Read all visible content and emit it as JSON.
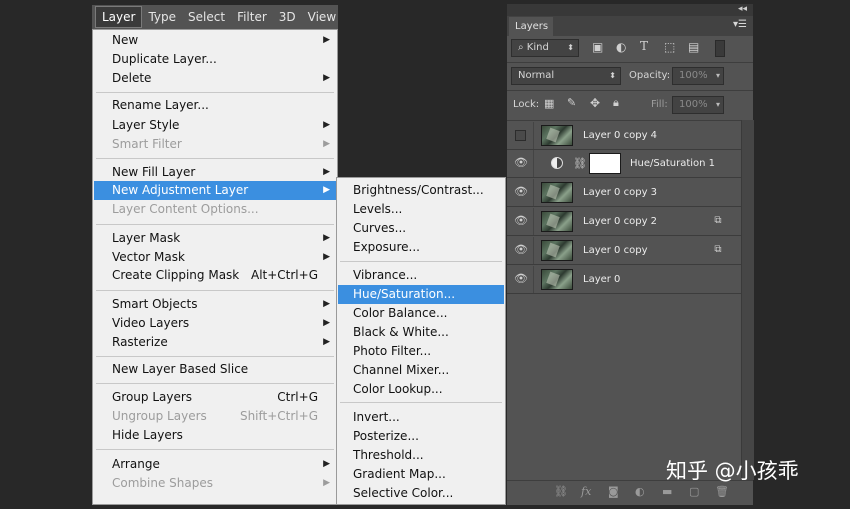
{
  "menubar": {
    "items": [
      "Layer",
      "Type",
      "Select",
      "Filter",
      "3D",
      "View"
    ]
  },
  "layer_menu": {
    "new": "New",
    "duplicate": "Duplicate Layer...",
    "delete": "Delete",
    "rename": "Rename Layer...",
    "layer_style": "Layer Style",
    "smart_filter": "Smart Filter",
    "new_fill": "New Fill Layer",
    "new_adjustment": "New Adjustment Layer",
    "content_options": "Layer Content Options...",
    "layer_mask": "Layer Mask",
    "vector_mask": "Vector Mask",
    "clipping_mask": "Create Clipping Mask",
    "clipping_mask_sc": "Alt+Ctrl+G",
    "smart_objects": "Smart Objects",
    "video_layers": "Video Layers",
    "rasterize": "Rasterize",
    "new_slice": "New Layer Based Slice",
    "group": "Group Layers",
    "group_sc": "Ctrl+G",
    "ungroup": "Ungroup Layers",
    "ungroup_sc": "Shift+Ctrl+G",
    "hide": "Hide Layers",
    "arrange": "Arrange",
    "combine": "Combine Shapes"
  },
  "adjustment_menu": {
    "brightness": "Brightness/Contrast...",
    "levels": "Levels...",
    "curves": "Curves...",
    "exposure": "Exposure...",
    "vibrance": "Vibrance...",
    "hue_sat": "Hue/Saturation...",
    "color_balance": "Color Balance...",
    "bw": "Black & White...",
    "photo_filter": "Photo Filter...",
    "channel_mixer": "Channel Mixer...",
    "color_lookup": "Color Lookup...",
    "invert": "Invert...",
    "posterize": "Posterize...",
    "threshold": "Threshold...",
    "gradient_map": "Gradient Map...",
    "selective_color": "Selective Color..."
  },
  "layers_panel": {
    "tab": "Layers",
    "filter_kind": "Kind",
    "blend_mode": "Normal",
    "opacity_label": "Opacity:",
    "opacity_value": "100%",
    "lock_label": "Lock:",
    "fill_label": "Fill:",
    "fill_value": "100%",
    "layers": [
      "Layer 0 copy 4",
      "Hue/Saturation 1",
      "Layer 0 copy 3",
      "Layer 0 copy 2",
      "Layer 0 copy",
      "Layer 0"
    ]
  },
  "watermark": "知乎 @小孩乖",
  "colors": {
    "highlight": "#3b8fe0",
    "menu_bg": "#f0f0f0",
    "panel_bg": "#535353",
    "background": "#282828"
  }
}
